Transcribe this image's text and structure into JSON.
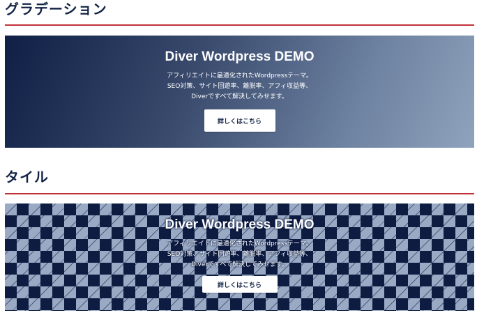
{
  "sections": [
    {
      "title": "グラデーション",
      "banner": {
        "heading": "Diver Wordpress DEMO",
        "lines": [
          "アフィリエイトに最適化されたWordpressテーマ。",
          "SEO対策、サイト回遊率、離脱率、アフィ収益等、",
          "Diverですべて解決してみせます。"
        ],
        "button_label": "詳しくはこちら"
      }
    },
    {
      "title": "タイル",
      "banner": {
        "heading": "Diver Wordpress DEMO",
        "lines": [
          "アフィリエイトに最適化されたWordpressテーマ。",
          "SEO対策、サイト回遊率、離脱率、アフィ収益等、",
          "Diverですべて解決してみせます。"
        ],
        "button_label": "詳しくはこちら"
      }
    }
  ],
  "colors": {
    "title_text": "#132446",
    "rule": "#c0313a",
    "navy": "#0e1c42",
    "gradient_light": "#8fa3bd",
    "tile_light": "#9aaac4",
    "button_bg": "#ffffff"
  }
}
